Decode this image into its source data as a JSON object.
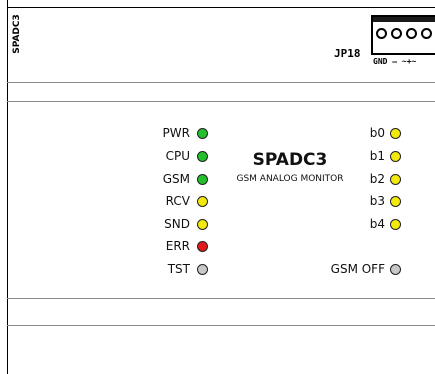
{
  "header": {
    "side_label": "SPADC3",
    "jumper": {
      "label": "JP18",
      "pin_labels": "GND  —  ~+~"
    }
  },
  "panel": {
    "title": "SPADC3",
    "subtitle": "GSM ANALOG MONITOR",
    "left_indicators": [
      {
        "label": "PWR",
        "state": "green",
        "color": "#22c02b"
      },
      {
        "label": "CPU",
        "state": "green",
        "color": "#22c02b"
      },
      {
        "label": "GSM",
        "state": "green",
        "color": "#22c02b"
      },
      {
        "label": "RCV",
        "state": "yellow",
        "color": "#f2ea0c"
      },
      {
        "label": "SND",
        "state": "yellow",
        "color": "#f2ea0c"
      },
      {
        "label": "ERR",
        "state": "red",
        "color": "#e3191c"
      },
      {
        "label": "TST",
        "state": "off",
        "color": "#c8c8c8"
      }
    ],
    "right_indicators": [
      {
        "label": "b0",
        "state": "yellow",
        "color": "#f2ea0c"
      },
      {
        "label": "b1",
        "state": "yellow",
        "color": "#f2ea0c"
      },
      {
        "label": "b2",
        "state": "yellow",
        "color": "#f2ea0c"
      },
      {
        "label": "b3",
        "state": "yellow",
        "color": "#f2ea0c"
      },
      {
        "label": "b4",
        "state": "yellow",
        "color": "#f2ea0c"
      },
      {
        "label": "GSM OFF",
        "state": "off",
        "color": "#c8c8c8"
      }
    ]
  }
}
